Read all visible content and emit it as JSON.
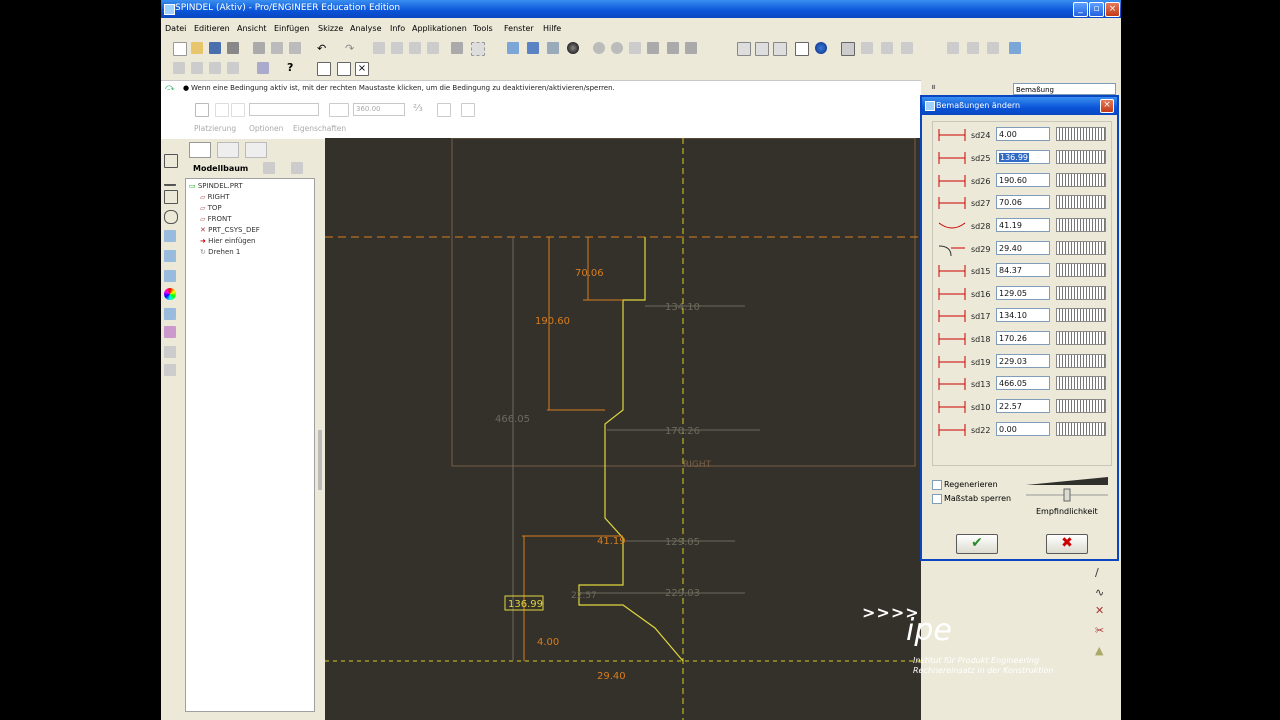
{
  "window": {
    "title": "SPINDEL (Aktiv) - Pro/ENGINEER Education Edition",
    "controls": [
      "_",
      "▫",
      "×"
    ]
  },
  "menu": [
    "Datei",
    "Editieren",
    "Ansicht",
    "Einfügen",
    "Skizze",
    "Analyse",
    "Info",
    "Applikationen",
    "Tools",
    "Fenster",
    "Hilfe"
  ],
  "dashboard": {
    "message": "Wenn eine Bedingung aktiv ist, mit der rechten Maustaste klicken, um die Bedingung zu deaktivieren/aktivieren/sperren.",
    "angle_value": "360.00",
    "tabs": [
      "Platzierung",
      "Optionen",
      "Eigenschaften"
    ],
    "filter_select": "Bemaßung"
  },
  "model_tree": {
    "title": "Modellbaum",
    "nodes": [
      "SPINDEL.PRT",
      "RIGHT",
      "TOP",
      "FRONT",
      "PRT_CSYS_DEF",
      "Hier einfügen",
      "Drehen 1"
    ]
  },
  "canvas": {
    "dims_orange": [
      "70.06",
      "190.60",
      "4.00",
      "29.40",
      "41.19"
    ],
    "dims_gray": [
      "466.05",
      "134.10",
      "170.26",
      "129.05",
      "229.03",
      "22.57"
    ],
    "selected_dim": "136.99",
    "datum_label": "RIGHT"
  },
  "dialog": {
    "title": "Bemaßungen ändern",
    "rows": [
      {
        "name": "sd24",
        "value": "4.00"
      },
      {
        "name": "sd25",
        "value": "136.99"
      },
      {
        "name": "sd26",
        "value": "190.60"
      },
      {
        "name": "sd27",
        "value": "70.06"
      },
      {
        "name": "sd28",
        "value": "41.19"
      },
      {
        "name": "sd29",
        "value": "29.40"
      },
      {
        "name": "sd15",
        "value": "84.37"
      },
      {
        "name": "sd16",
        "value": "129.05"
      },
      {
        "name": "sd17",
        "value": "134.10"
      },
      {
        "name": "sd18",
        "value": "170.26"
      },
      {
        "name": "sd19",
        "value": "229.03"
      },
      {
        "name": "sd13",
        "value": "466.05"
      },
      {
        "name": "sd10",
        "value": "22.57"
      },
      {
        "name": "sd22",
        "value": "0.00"
      }
    ],
    "regen_label": "Regenerieren",
    "scale_label": "Maßstab sperren",
    "sensitivity_label": "Empfindlichkeit",
    "ok_symbol": "✔",
    "cancel_symbol": "✖"
  },
  "logo": {
    "arrows": ">>>>",
    "name": "ipe",
    "line1": "Institut für Produkt Engineering",
    "line2": "Rechnereinsatz in der Konstruktion"
  }
}
